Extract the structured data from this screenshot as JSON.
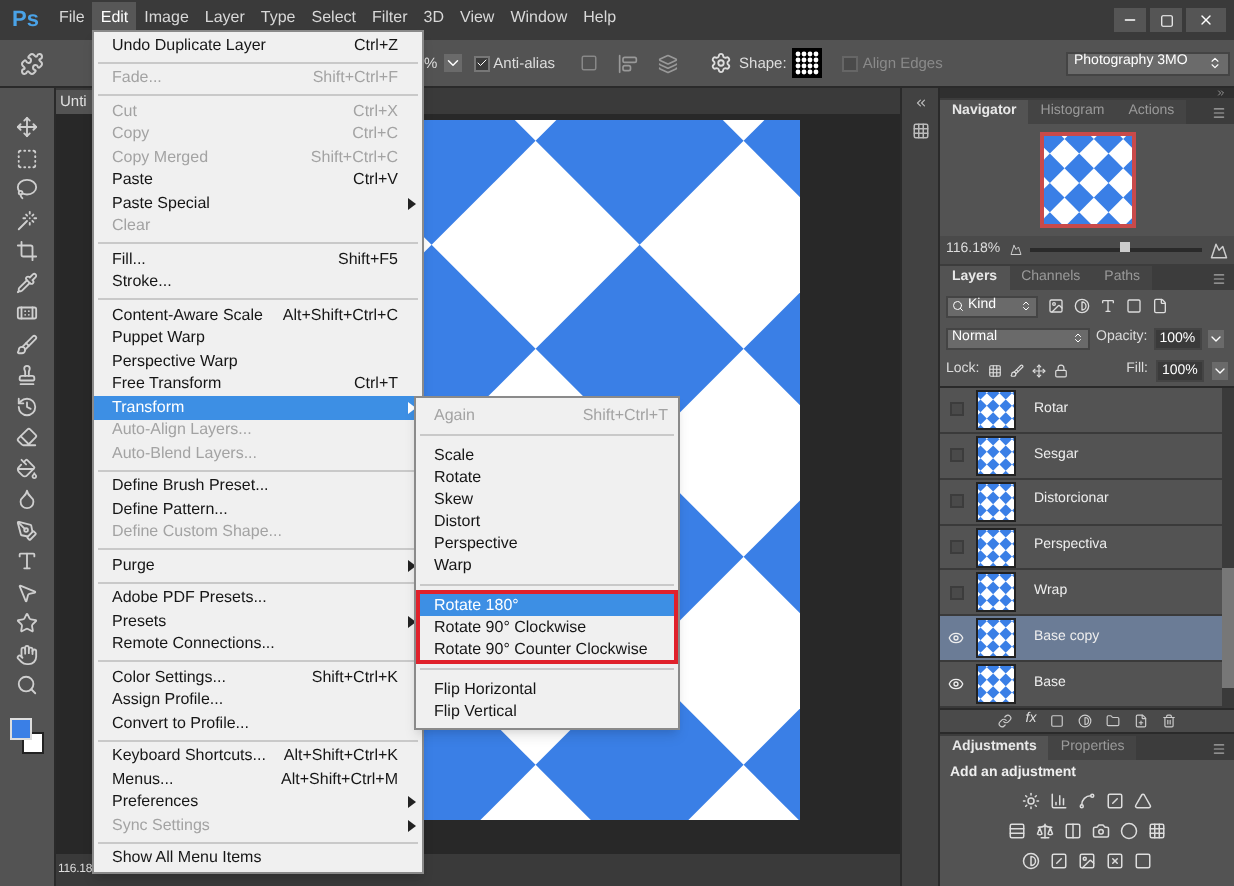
{
  "menu_bar": {
    "logo": "Ps",
    "items": [
      {
        "label": "File",
        "selected": false
      },
      {
        "label": "Edit",
        "selected": true
      },
      {
        "label": "Image",
        "selected": false
      },
      {
        "label": "Layer",
        "selected": false
      },
      {
        "label": "Type",
        "selected": false
      },
      {
        "label": "Select",
        "selected": false
      },
      {
        "label": "Filter",
        "selected": false
      },
      {
        "label": "3D",
        "selected": false
      },
      {
        "label": "View",
        "selected": false
      },
      {
        "label": "Window",
        "selected": false
      },
      {
        "label": "Help",
        "selected": false
      }
    ]
  },
  "options_bar": {
    "percent_fragment": "%",
    "anti_alias": {
      "label": "Anti-alias",
      "checked": true
    },
    "shape_label": "Shape:",
    "align_edges": {
      "label": "Align Edges",
      "checked": false,
      "disabled": true
    },
    "workspace": "Photography 3MO"
  },
  "document": {
    "tab": "Unti",
    "zoom": "116.18"
  },
  "edit_menu": [
    {
      "kind": "item",
      "label": "Undo Duplicate Layer",
      "shortcut": "Ctrl+Z",
      "disabled": false,
      "submenu": false,
      "selected": false
    },
    {
      "kind": "separator"
    },
    {
      "kind": "item",
      "label": "Fade...",
      "shortcut": "Shift+Ctrl+F",
      "disabled": true,
      "submenu": false,
      "selected": false
    },
    {
      "kind": "separator"
    },
    {
      "kind": "item",
      "label": "Cut",
      "shortcut": "Ctrl+X",
      "disabled": true,
      "submenu": false,
      "selected": false
    },
    {
      "kind": "item",
      "label": "Copy",
      "shortcut": "Ctrl+C",
      "disabled": true,
      "submenu": false,
      "selected": false
    },
    {
      "kind": "item",
      "label": "Copy Merged",
      "shortcut": "Shift+Ctrl+C",
      "disabled": true,
      "submenu": false,
      "selected": false
    },
    {
      "kind": "item",
      "label": "Paste",
      "shortcut": "Ctrl+V",
      "disabled": false,
      "submenu": false,
      "selected": false
    },
    {
      "kind": "item",
      "label": "Paste Special",
      "disabled": false,
      "submenu": true,
      "selected": false
    },
    {
      "kind": "item",
      "label": "Clear",
      "disabled": true,
      "submenu": false,
      "selected": false
    },
    {
      "kind": "separator"
    },
    {
      "kind": "item",
      "label": "Fill...",
      "shortcut": "Shift+F5",
      "disabled": false,
      "submenu": false,
      "selected": false
    },
    {
      "kind": "item",
      "label": "Stroke...",
      "disabled": false,
      "submenu": false,
      "selected": false
    },
    {
      "kind": "separator"
    },
    {
      "kind": "item",
      "label": "Content-Aware Scale",
      "shortcut": "Alt+Shift+Ctrl+C",
      "disabled": false,
      "submenu": false,
      "selected": false
    },
    {
      "kind": "item",
      "label": "Puppet Warp",
      "disabled": false,
      "submenu": false,
      "selected": false
    },
    {
      "kind": "item",
      "label": "Perspective Warp",
      "disabled": false,
      "submenu": false,
      "selected": false
    },
    {
      "kind": "item",
      "label": "Free Transform",
      "shortcut": "Ctrl+T",
      "disabled": false,
      "submenu": false,
      "selected": false
    },
    {
      "kind": "item",
      "label": "Transform",
      "disabled": false,
      "submenu": true,
      "selected": true
    },
    {
      "kind": "item",
      "label": "Auto-Align Layers...",
      "disabled": true,
      "submenu": false,
      "selected": false
    },
    {
      "kind": "item",
      "label": "Auto-Blend Layers...",
      "disabled": true,
      "submenu": false,
      "selected": false
    },
    {
      "kind": "separator"
    },
    {
      "kind": "item",
      "label": "Define Brush Preset...",
      "disabled": false,
      "submenu": false,
      "selected": false
    },
    {
      "kind": "item",
      "label": "Define Pattern...",
      "disabled": false,
      "submenu": false,
      "selected": false
    },
    {
      "kind": "item",
      "label": "Define Custom Shape...",
      "disabled": true,
      "submenu": false,
      "selected": false
    },
    {
      "kind": "separator"
    },
    {
      "kind": "item",
      "label": "Purge",
      "disabled": false,
      "submenu": true,
      "selected": false
    },
    {
      "kind": "separator"
    },
    {
      "kind": "item",
      "label": "Adobe PDF Presets...",
      "disabled": false,
      "submenu": false,
      "selected": false
    },
    {
      "kind": "item",
      "label": "Presets",
      "disabled": false,
      "submenu": true,
      "selected": false
    },
    {
      "kind": "item",
      "label": "Remote Connections...",
      "disabled": false,
      "submenu": false,
      "selected": false
    },
    {
      "kind": "separator"
    },
    {
      "kind": "item",
      "label": "Color Settings...",
      "shortcut": "Shift+Ctrl+K",
      "disabled": false,
      "submenu": false,
      "selected": false
    },
    {
      "kind": "item",
      "label": "Assign Profile...",
      "disabled": false,
      "submenu": false,
      "selected": false
    },
    {
      "kind": "item",
      "label": "Convert to Profile...",
      "disabled": false,
      "submenu": false,
      "selected": false
    },
    {
      "kind": "separator"
    },
    {
      "kind": "item",
      "label": "Keyboard Shortcuts...",
      "shortcut": "Alt+Shift+Ctrl+K",
      "disabled": false,
      "submenu": false,
      "selected": false
    },
    {
      "kind": "item",
      "label": "Menus...",
      "shortcut": "Alt+Shift+Ctrl+M",
      "disabled": false,
      "submenu": false,
      "selected": false
    },
    {
      "kind": "item",
      "label": "Preferences",
      "disabled": false,
      "submenu": true,
      "selected": false
    },
    {
      "kind": "item",
      "label": "Sync Settings",
      "disabled": true,
      "submenu": true,
      "selected": false
    },
    {
      "kind": "separator"
    },
    {
      "kind": "item",
      "label": "Show All Menu Items",
      "disabled": false,
      "submenu": false,
      "selected": false
    }
  ],
  "transform_submenu": [
    {
      "highlighted": false,
      "items": [
        {
          "label": "Again",
          "shortcut": "Shift+Ctrl+T",
          "disabled": true,
          "selected": false
        }
      ]
    },
    {
      "highlighted": false,
      "items": [
        {
          "label": "Scale",
          "disabled": false,
          "selected": false
        },
        {
          "label": "Rotate",
          "disabled": false,
          "selected": false
        },
        {
          "label": "Skew",
          "disabled": false,
          "selected": false
        },
        {
          "label": "Distort",
          "disabled": false,
          "selected": false
        },
        {
          "label": "Perspective",
          "disabled": false,
          "selected": false
        },
        {
          "label": "Warp",
          "disabled": false,
          "selected": false
        }
      ]
    },
    {
      "highlighted": true,
      "items": [
        {
          "label": "Rotate 180°",
          "disabled": false,
          "selected": true
        },
        {
          "label": "Rotate 90° Clockwise",
          "disabled": false,
          "selected": false
        },
        {
          "label": "Rotate 90° Counter Clockwise",
          "disabled": false,
          "selected": false
        }
      ]
    },
    {
      "highlighted": false,
      "items": [
        {
          "label": "Flip Horizontal",
          "disabled": false,
          "selected": false
        },
        {
          "label": "Flip Vertical",
          "disabled": false,
          "selected": false
        }
      ]
    }
  ],
  "navigator_panel": {
    "tabs": [
      {
        "label": "Navigator",
        "selected": true
      },
      {
        "label": "Histogram",
        "selected": false
      },
      {
        "label": "Actions",
        "selected": false
      }
    ],
    "zoom": "116.18%",
    "slider": {
      "level": 0.55
    }
  },
  "layers_panel": {
    "tabs": [
      {
        "label": "Layers",
        "selected": true
      },
      {
        "label": "Channels",
        "selected": false
      },
      {
        "label": "Paths",
        "selected": false
      }
    ],
    "filter": "Kind",
    "blend_mode": "Normal",
    "opacity_label": "Opacity:",
    "opacity": "100%",
    "lock_label": "Lock:",
    "fill_label": "Fill:",
    "fill": "100%",
    "fx": "fx",
    "layers": [
      {
        "name": "Rotar",
        "visible": false,
        "selected": false
      },
      {
        "name": "Sesgar",
        "visible": false,
        "selected": false
      },
      {
        "name": "Distorcionar",
        "visible": false,
        "selected": false
      },
      {
        "name": "Perspectiva",
        "visible": false,
        "selected": false
      },
      {
        "name": "Wrap",
        "visible": false,
        "selected": false
      },
      {
        "name": "Base copy",
        "visible": true,
        "selected": true
      },
      {
        "name": "Base",
        "visible": true,
        "selected": false
      }
    ]
  },
  "adjustments_panel": {
    "tabs": [
      {
        "label": "Adjustments",
        "selected": true
      },
      {
        "label": "Properties",
        "selected": false
      }
    ],
    "heading": "Add an adjustment"
  }
}
